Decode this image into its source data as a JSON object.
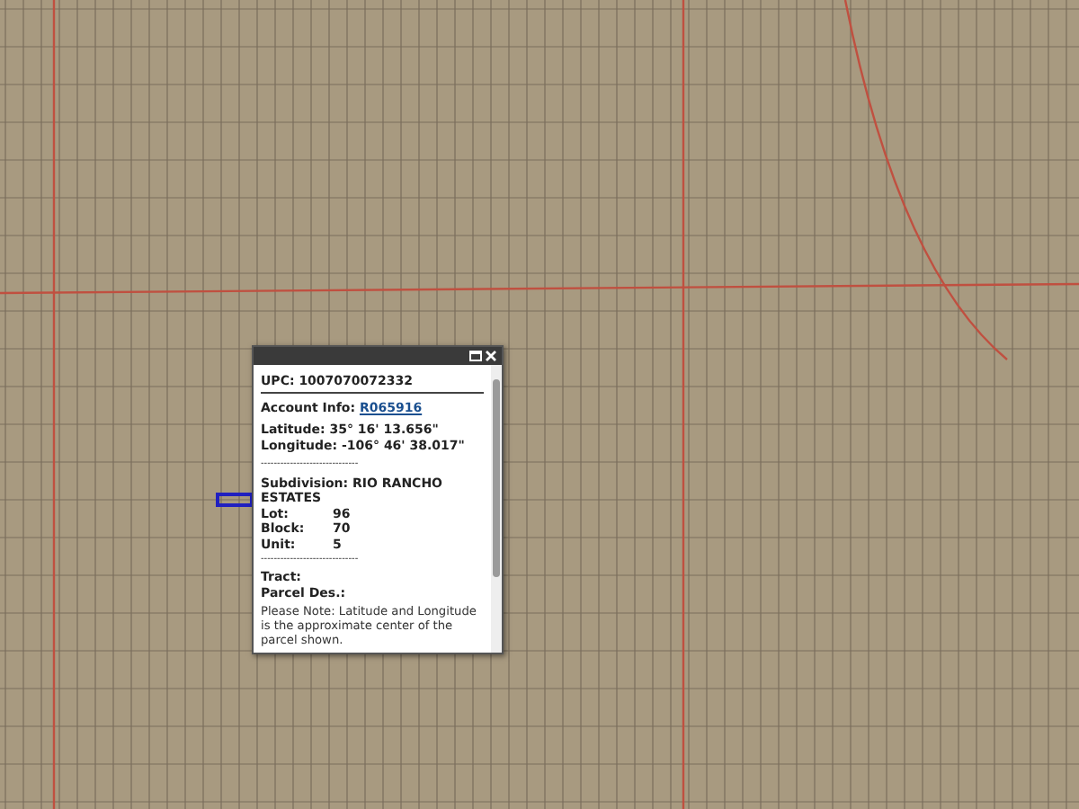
{
  "popup": {
    "upc": "UPC: 1007070072332",
    "account_label": "Account Info:",
    "account_link": "R065916",
    "latitude": "Latitude: 35° 16' 13.656\"",
    "longitude": "Longitude: -106° 46' 38.017\"",
    "separator": "------------------------------",
    "subdivision": "Subdivision: RIO RANCHO ESTATES",
    "fields": [
      {
        "label": "Lot:",
        "value": "96"
      },
      {
        "label": "Block:",
        "value": "70"
      },
      {
        "label": "Unit:",
        "value": "5"
      }
    ],
    "separator_2": "------------------------------",
    "tract": "Tract:",
    "parcel": "Parcel Des.:",
    "note": "Please Note: Latitude and Longitude is the approximate center of the parcel shown."
  }
}
